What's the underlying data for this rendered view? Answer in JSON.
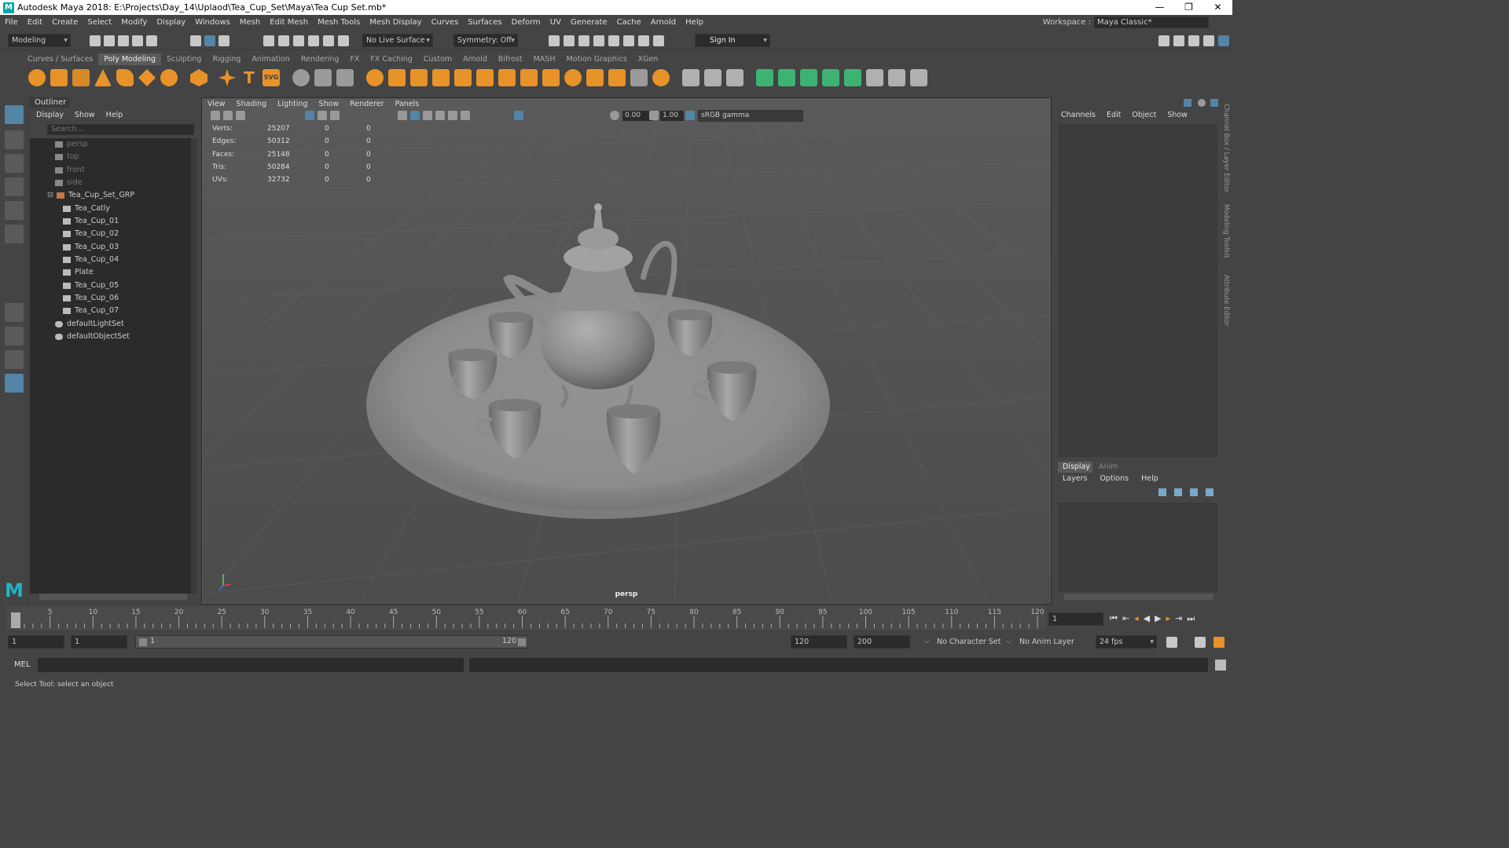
{
  "titlebar": {
    "title": "Autodesk Maya 2018: E:\\Projects\\Day_14\\Uplaod\\Tea_Cup_Set\\Maya\\Tea Cup Set.mb*",
    "minimize": "—",
    "maximize": "❐",
    "close": "✕"
  },
  "menubar": {
    "items": [
      "File",
      "Edit",
      "Create",
      "Select",
      "Modify",
      "Display",
      "Windows",
      "Mesh",
      "Edit Mesh",
      "Mesh Tools",
      "Mesh Display",
      "Curves",
      "Surfaces",
      "Deform",
      "UV",
      "Generate",
      "Cache",
      "Arnold",
      "Help"
    ],
    "workspace_label": "Workspace :",
    "workspace_value": "Maya Classic*"
  },
  "statusline": {
    "mode": "Modeling",
    "live_surface": "No Live Surface",
    "symmetry": "Symmetry: Off",
    "sign_in": "Sign In"
  },
  "shelf": {
    "tabs": [
      "Curves / Surfaces",
      "Poly Modeling",
      "Sculpting",
      "Rigging",
      "Animation",
      "Rendering",
      "FX",
      "FX Caching",
      "Custom",
      "Arnold",
      "Bifrost",
      "MASH",
      "Motion Graphics",
      "XGen"
    ],
    "active_tab": "Poly Modeling",
    "accent": "#e8922a"
  },
  "outliner": {
    "title": "Outliner",
    "menu": [
      "Display",
      "Show",
      "Help"
    ],
    "search_placeholder": "Search...",
    "cameras": [
      "persp",
      "top",
      "front",
      "side"
    ],
    "group": "Tea_Cup_Set_GRP",
    "children": [
      "Tea_Catly",
      "Tea_Cup_01",
      "Tea_Cup_02",
      "Tea_Cup_03",
      "Tea_Cup_04",
      "Plate",
      "Tea_Cup_05",
      "Tea_Cup_06",
      "Tea_Cup_07"
    ],
    "sets": [
      "defaultLightSet",
      "defaultObjectSet"
    ]
  },
  "viewport": {
    "menu": [
      "View",
      "Shading",
      "Lighting",
      "Show",
      "Renderer",
      "Panels"
    ],
    "exposure": "0.00",
    "gamma": "1.00",
    "color_space": "sRGB gamma",
    "camera_label": "persp",
    "hud": [
      {
        "label": "Verts:",
        "v1": "25207",
        "v2": "0",
        "v3": "0"
      },
      {
        "label": "Edges:",
        "v1": "50312",
        "v2": "0",
        "v3": "0"
      },
      {
        "label": "Faces:",
        "v1": "25148",
        "v2": "0",
        "v3": "0"
      },
      {
        "label": "Tris:",
        "v1": "50284",
        "v2": "0",
        "v3": "0"
      },
      {
        "label": "UVs:",
        "v1": "32732",
        "v2": "0",
        "v3": "0"
      }
    ]
  },
  "channelbox": {
    "menu": [
      "Channels",
      "Edit",
      "Object",
      "Show"
    ]
  },
  "layereditor": {
    "tabs": [
      "Display",
      "Anim"
    ],
    "menu": [
      "Layers",
      "Options",
      "Help"
    ]
  },
  "sidetabs": [
    "Channel Box / Layer Editor",
    "Modeling Toolkit",
    "Attribute Editor"
  ],
  "timeline": {
    "ticks": [
      "1",
      "5",
      "10",
      "15",
      "20",
      "25",
      "30",
      "35",
      "40",
      "45",
      "50",
      "55",
      "60",
      "65",
      "70",
      "75",
      "80",
      "85",
      "90",
      "95",
      "100",
      "105",
      "110",
      "115",
      "120"
    ],
    "current_frame": "1"
  },
  "range": {
    "start": "1",
    "playback_start": "1",
    "slider_start": "1",
    "slider_end": "120",
    "playback_end": "120",
    "end": "200",
    "character_set": "No Character Set",
    "anim_layer": "No Anim Layer",
    "fps": "24 fps"
  },
  "cmdline": {
    "label": "MEL"
  },
  "helpline": {
    "text": "Select Tool: select an object"
  }
}
